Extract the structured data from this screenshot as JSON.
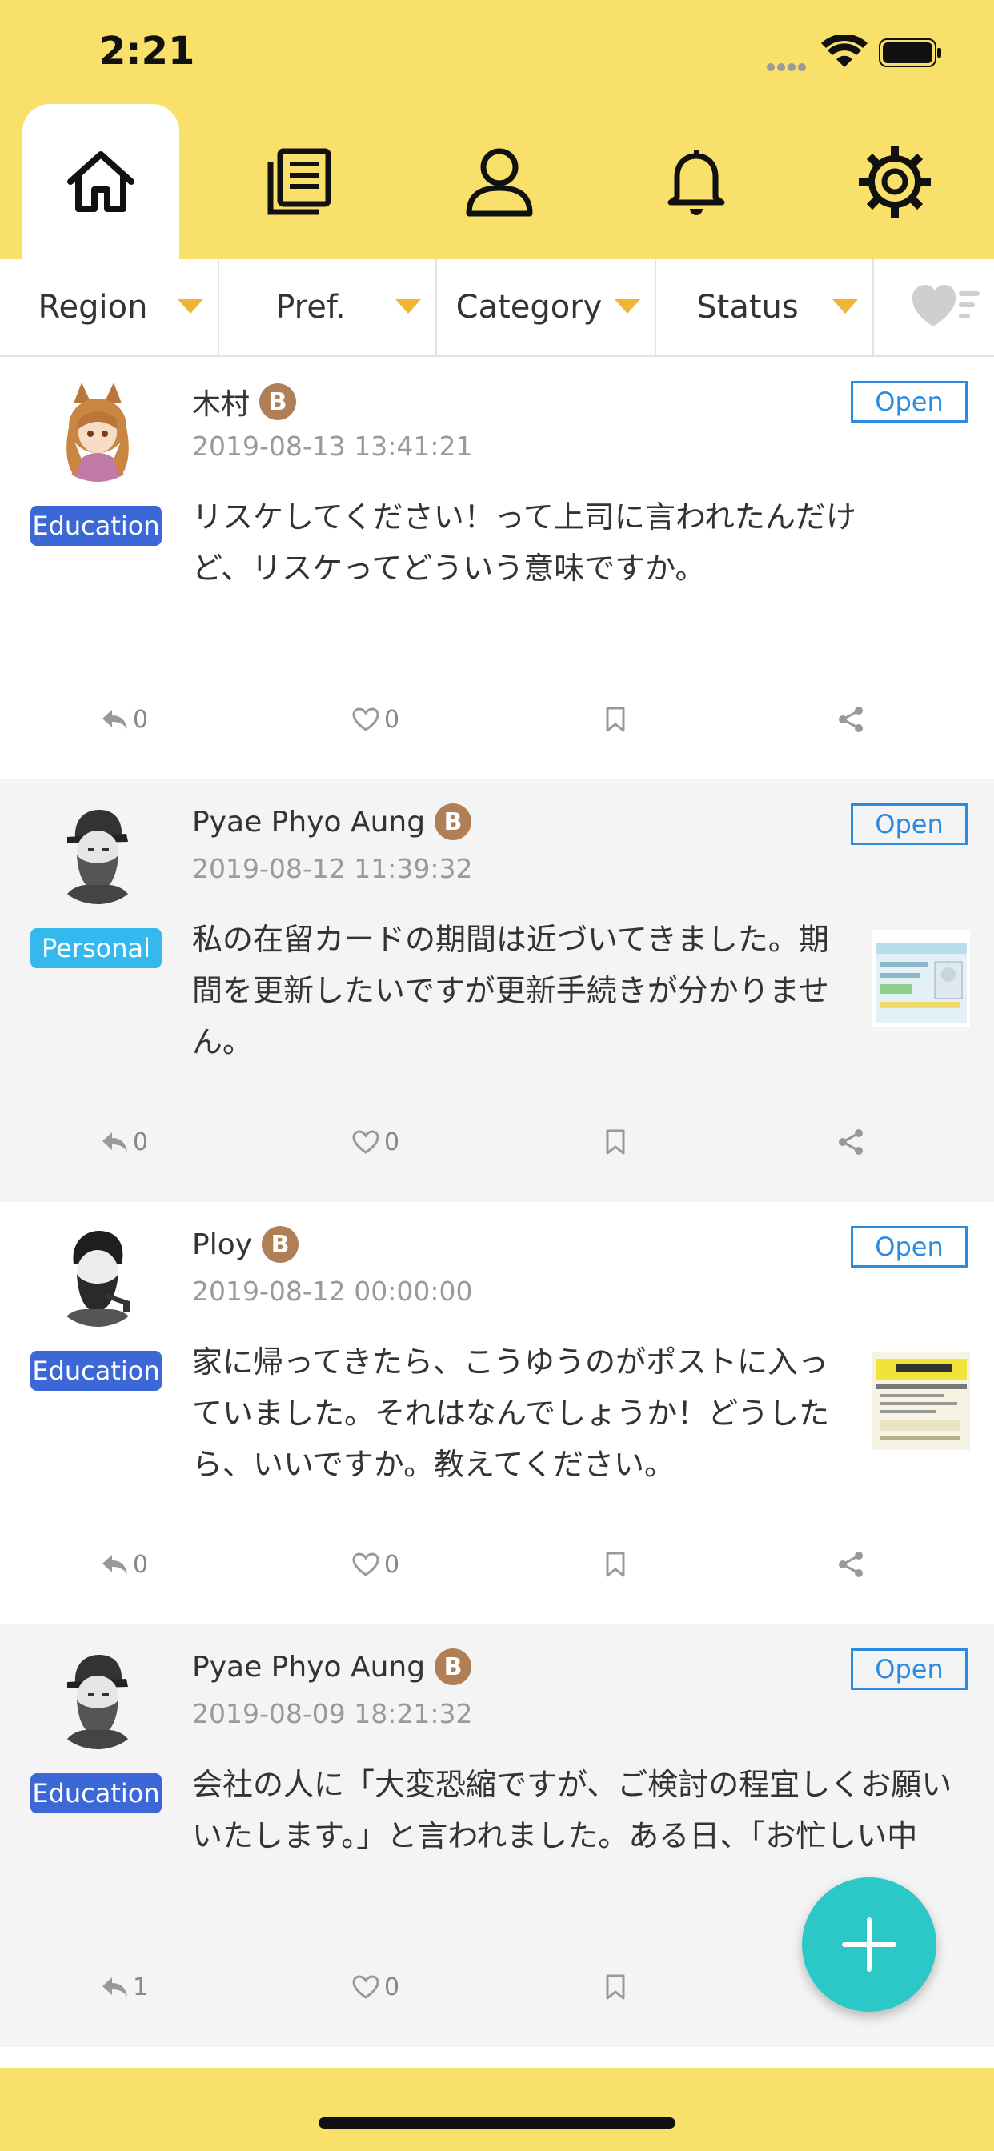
{
  "status_bar": {
    "time": "2:21"
  },
  "tabs": [
    {
      "name": "home",
      "icon": "home-icon",
      "active": true
    },
    {
      "name": "articles",
      "icon": "news-icon",
      "active": false
    },
    {
      "name": "profile",
      "icon": "person-icon",
      "active": false
    },
    {
      "name": "notifications",
      "icon": "bell-icon",
      "active": false
    },
    {
      "name": "settings",
      "icon": "gear-icon",
      "active": false
    }
  ],
  "filters": [
    {
      "label": "Region"
    },
    {
      "label": "Pref."
    },
    {
      "label": "Category"
    },
    {
      "label": "Status"
    }
  ],
  "posts": [
    {
      "author": "木村",
      "badge": "B",
      "date": "2019-08-13 13:41:21",
      "status": "Open",
      "category": "Education",
      "category_color": "#3b68d6",
      "text": "リスケしてください！って上司に言われたんだけど、リスケってどういう意味ですか。",
      "replies": "0",
      "likes": "0"
    },
    {
      "author": "Pyae Phyo Aung",
      "badge": "B",
      "date": "2019-08-12 11:39:32",
      "status": "Open",
      "category": "Personal",
      "category_color": "#35b8ee",
      "text": "私の在留カードの期間は近づいてきました。期間を更新したいですが更新手続きが分かりません。",
      "replies": "0",
      "likes": "0"
    },
    {
      "author": "Ploy",
      "badge": "B",
      "date": "2019-08-12 00:00:00",
      "status": "Open",
      "category": "Education",
      "category_color": "#3b68d6",
      "text": "家に帰ってきたら、こうゆうのがポストに入っていました。それはなんでしょうか！どうしたら、いいですか。教えてください。",
      "replies": "0",
      "likes": "0"
    },
    {
      "author": "Pyae Phyo Aung",
      "badge": "B",
      "date": "2019-08-09 18:21:32",
      "status": "Open",
      "category": "Education",
      "category_color": "#3b68d6",
      "text": "会社の人に「大変恐縮ですが、ご検討の程宜しくお願いいたします。」と言われました。ある日、「お忙しい中",
      "replies": "1",
      "likes": "0"
    }
  ],
  "colors": {
    "header_yellow": "#f8e06a",
    "accent_teal": "#2cc7c7",
    "open_blue": "#2a8be0",
    "badge_brown": "#b17f55"
  }
}
